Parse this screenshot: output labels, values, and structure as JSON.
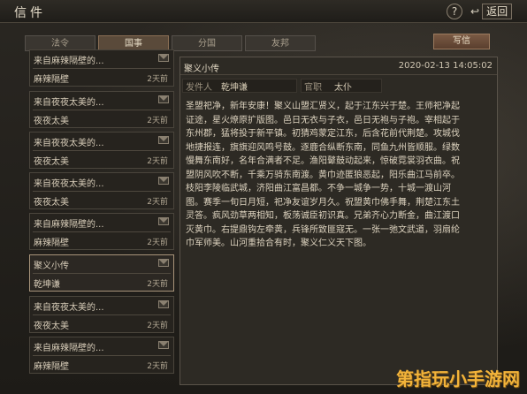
{
  "header": {
    "title": "信件",
    "help": "?",
    "back_arrow": "↩",
    "back_label": "返回"
  },
  "tabs": [
    {
      "label": "法令",
      "active": false
    },
    {
      "label": "国事",
      "active": true
    },
    {
      "label": "分国",
      "active": false
    },
    {
      "label": "友邦",
      "active": false
    }
  ],
  "send_label": "写信",
  "list": {
    "items": [
      {
        "sender": "来自麻辣隔壁的...",
        "title": "麻辣隔壁",
        "days": "2天前"
      },
      {
        "sender": "来自夜夜太美的...",
        "title": "夜夜太美",
        "days": "2天前"
      },
      {
        "sender": "来自夜夜太美的...",
        "title": "夜夜太美",
        "days": "2天前"
      },
      {
        "sender": "来自夜夜太美的...",
        "title": "夜夜太美",
        "days": "2天前"
      },
      {
        "sender": "来自麻辣隔壁的...",
        "title": "麻辣隔壁",
        "days": "2天前"
      },
      {
        "sender": "聚义小传",
        "title": "乾坤谦",
        "days": "2天前"
      },
      {
        "sender": "来自夜夜太美的...",
        "title": "夜夜太美",
        "days": "2天前"
      },
      {
        "sender": "来自麻辣隔壁的...",
        "title": "麻辣隔壁",
        "days": "2天前"
      }
    ]
  },
  "mail": {
    "title": "聚义小传",
    "date": "2020-02-13 14:05:02",
    "sender_label": "发件人",
    "sender": "乾坤谦",
    "office_label": "官职",
    "office": "太仆",
    "body": [
      "圣盟祀净，新年安康！聚义山盟汇贤义，起于江东兴于楚。王师祀净起",
      "证途，星火燎原扩版图。邑日无衣与子衣，邑日无袍与子袍。宰相起于",
      "东州郡，猛将投于新平镇。初猜鸡蒙定江东，后含花前代荆楚。攻城伐",
      "地捷报连，旗旗迎风鸣号鼓。逐鹿合纵断东南，同鱼九州皆顺服。绿数",
      "慢舞东南好，名年合满者不足。渔阳鼙鼓动起来，惊破霓裳羽衣曲。祝",
      "盟阴风吹不断，千乘万骑东南渡。黄巾迹匿狼恶起，阳乐曲江马前卒。",
      "枝阳李陵临武城，济阳曲江富昌都。不争一城争一势，十城一渡山河",
      "图。赛季一旬日月短，祀净友谊岁月久。祝盟黄巾佛手舞，荆楚江东土",
      "灵答。疯风劲草两相知，板荡诚臣初识真。兄弟齐心力断金，曲江渡口",
      "灭黄巾。右提鼎钩左牵黄，兵锋所致匪寇无。一张一弛文武道，羽扇纶",
      "巾军师美。山河重拾合有时，聚义仁义天下图。"
    ]
  },
  "watermark": "第指玩小手游网",
  "colors": {
    "accent": "#a8947a",
    "send": "#7a5a44"
  }
}
